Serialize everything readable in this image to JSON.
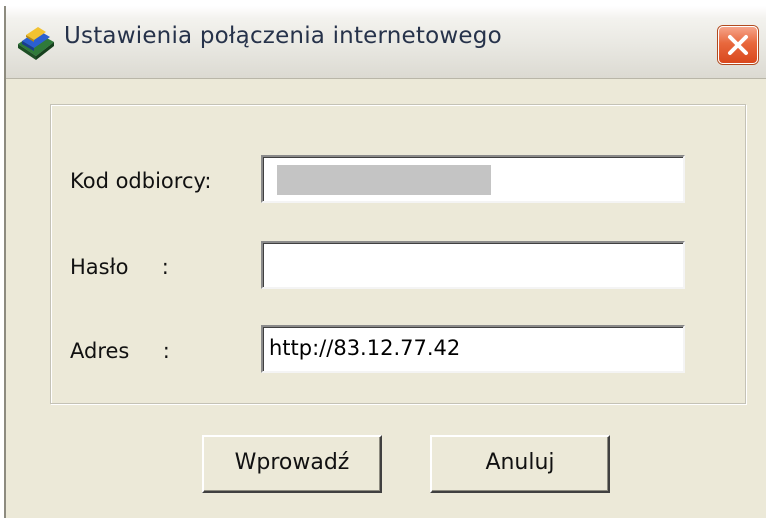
{
  "window": {
    "title": "Ustawienia połączenia internetowego"
  },
  "form": {
    "recipient_code_label": "Kod odbiorcy:",
    "recipient_code_value": "",
    "password_label": "Hasło     :",
    "password_value": "",
    "address_label": "Adres     :",
    "address_value": "http://83.12.77.42"
  },
  "buttons": {
    "submit_label": "Wprowadź",
    "cancel_label": "Anuluj"
  },
  "icons": {
    "app": "connection-book-icon",
    "close": "close-icon"
  },
  "colors": {
    "dialog_background": "#ece9d8",
    "close_button": "#e0592e"
  }
}
